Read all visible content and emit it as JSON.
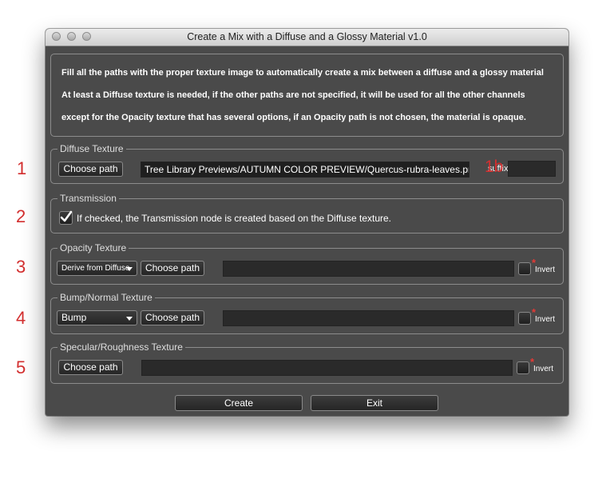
{
  "window": {
    "title": "Create a Mix with a Diffuse and a Glossy Material v1.0"
  },
  "info": {
    "lines": [
      "Fill all the paths with the proper texture image to automatically create a mix between a diffuse and a glossy material",
      "At least a Diffuse texture is needed, if the other paths are not specified, it will be used for all the other channels",
      "except for the Opacity texture that has several options, if an Opacity path is not chosen, the material is opaque."
    ]
  },
  "annotations": {
    "n1": "1",
    "n1b": "1b",
    "n2": "2",
    "n3": "3",
    "n4": "4",
    "n5": "5",
    "star": "*"
  },
  "diffuse": {
    "legend": "Diffuse Texture",
    "choose_label": "Choose path",
    "path_value": "Tree Library Previews/AUTUMN COLOR PREVIEW/Quercus-rubra-leaves.png",
    "suffix_label": "suffix",
    "suffix_value": ""
  },
  "transmission": {
    "legend": "Transmission",
    "checked": true,
    "label": "If checked, the Transmission node is created based on the Diffuse texture."
  },
  "opacity": {
    "legend": "Opacity Texture",
    "mode_selected": "Derive from Diffuse",
    "choose_label": "Choose path",
    "path_value": "",
    "invert_label": "Invert"
  },
  "bump": {
    "legend": "Bump/Normal Texture",
    "mode_selected": "Bump",
    "choose_label": "Choose path",
    "path_value": "",
    "invert_label": "Invert"
  },
  "specular": {
    "legend": "Specular/Roughness Texture",
    "choose_label": "Choose path",
    "path_value": "",
    "invert_label": "Invert"
  },
  "actions": {
    "create_label": "Create",
    "exit_label": "Exit"
  },
  "colors": {
    "window_bg": "#4a4a4a",
    "field_bg": "#2a2a2a",
    "annotation": "#d32f2f"
  },
  "icons": {
    "checkmark": "checkmark-icon",
    "dropdown": "chevron-down-icon"
  }
}
